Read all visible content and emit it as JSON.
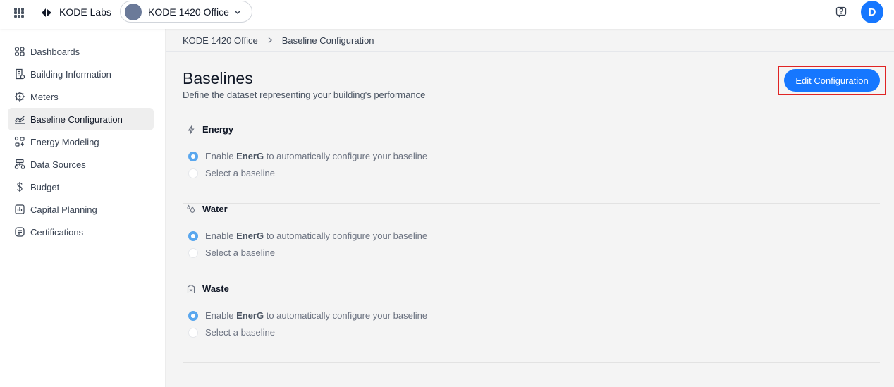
{
  "topbar": {
    "brand": "KODE Labs",
    "site_name": "KODE 1420 Office",
    "user_initial": "D"
  },
  "sidebar": {
    "items": [
      {
        "label": "Dashboards",
        "icon": "dashboards-icon",
        "active": false
      },
      {
        "label": "Building Information",
        "icon": "building-icon",
        "active": false
      },
      {
        "label": "Meters",
        "icon": "meter-icon",
        "active": false
      },
      {
        "label": "Baseline Configuration",
        "icon": "baseline-chart-icon",
        "active": true
      },
      {
        "label": "Energy Modeling",
        "icon": "energy-modeling-icon",
        "active": false
      },
      {
        "label": "Data Sources",
        "icon": "data-sources-icon",
        "active": false
      },
      {
        "label": "Budget",
        "icon": "dollar-icon",
        "active": false
      },
      {
        "label": "Capital Planning",
        "icon": "capital-planning-icon",
        "active": false
      },
      {
        "label": "Certifications",
        "icon": "certification-icon",
        "active": false
      }
    ]
  },
  "breadcrumb": {
    "items": [
      "KODE 1420 Office",
      "Baseline Configuration"
    ]
  },
  "main": {
    "title": "Baselines",
    "subtitle": "Define the dataset representing your building's performance",
    "edit_button": "Edit Configuration",
    "sections": [
      {
        "title": "Energy",
        "icon": "lightning-icon",
        "option1_prefix": "Enable ",
        "option1_bold": "EnerG",
        "option1_suffix": " to automatically configure your baseline",
        "option2": "Select a baseline"
      },
      {
        "title": "Water",
        "icon": "water-drops-icon",
        "option1_prefix": "Enable ",
        "option1_bold": "EnerG",
        "option1_suffix": " to automatically configure your baseline",
        "option2": "Select a baseline"
      },
      {
        "title": "Waste",
        "icon": "waste-bin-icon",
        "option1_prefix": "Enable ",
        "option1_bold": "EnerG",
        "option1_suffix": " to automatically configure your baseline",
        "option2": "Select a baseline"
      }
    ]
  },
  "colors": {
    "accent": "#1677ff",
    "radio_checked": "#5aa7ee",
    "highlight_border": "#e02424"
  }
}
